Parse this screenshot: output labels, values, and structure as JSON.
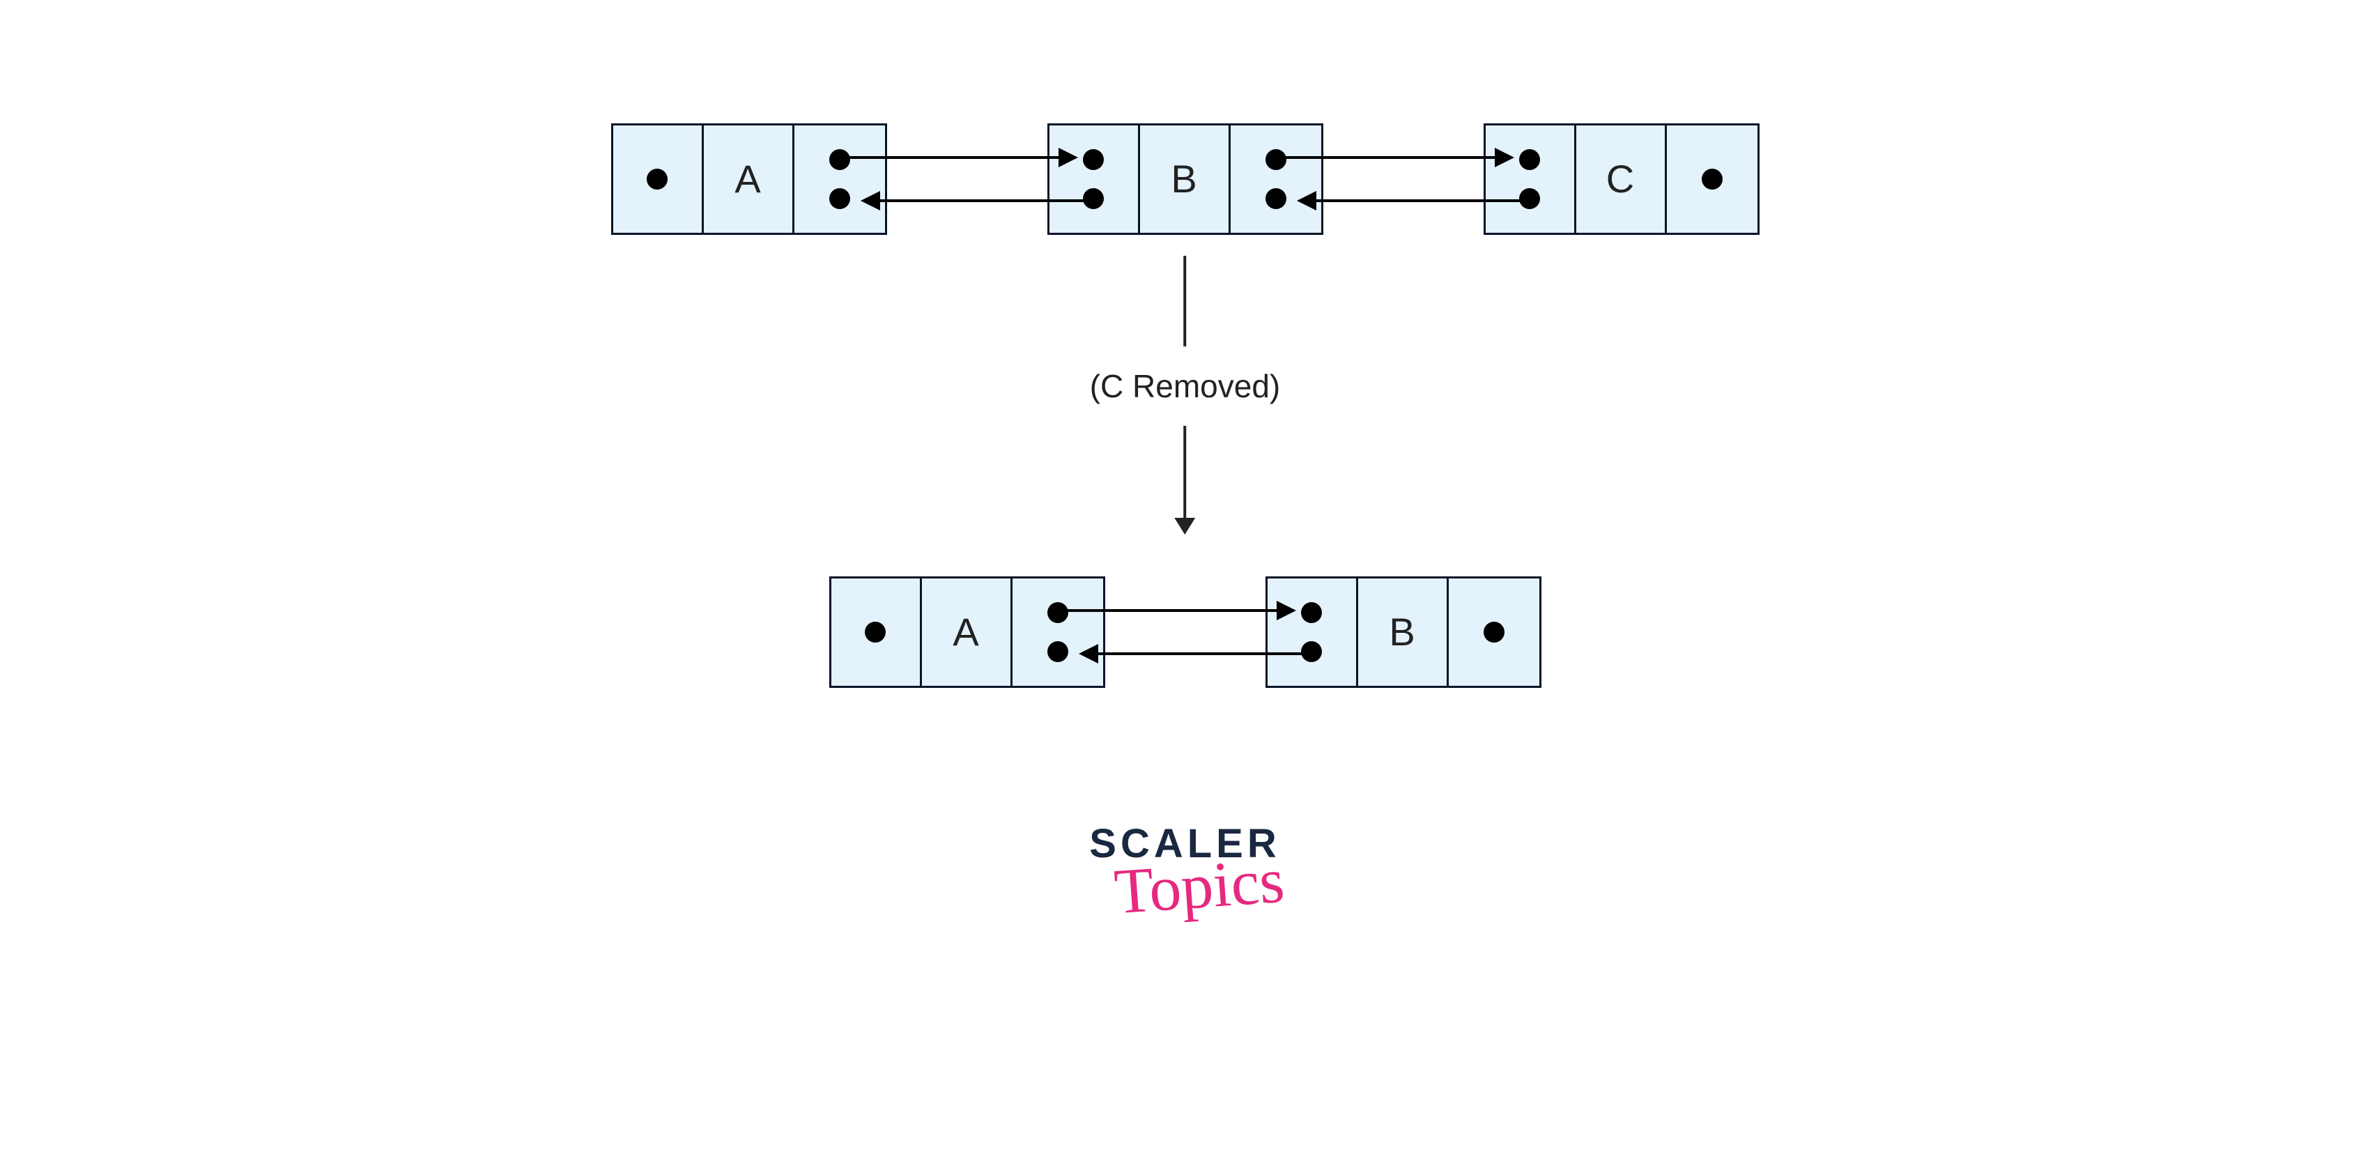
{
  "diagram": {
    "before": {
      "nodes": [
        {
          "prev": "null",
          "data": "A",
          "next": "ptr"
        },
        {
          "prev": "ptr",
          "data": "B",
          "next": "ptr"
        },
        {
          "prev": "ptr",
          "data": "C",
          "next": "null"
        }
      ]
    },
    "transition_label": "(C Removed)",
    "after": {
      "nodes": [
        {
          "prev": "null",
          "data": "A",
          "next": "ptr"
        },
        {
          "prev": "ptr",
          "data": "B",
          "next": "null"
        }
      ]
    }
  },
  "brand": {
    "line1": "SCALER",
    "line2": "Topics"
  },
  "colors": {
    "node_fill": "#e3f2fb",
    "node_border": "#0a1428",
    "text": "#222222",
    "brand_dark": "#1a2840",
    "brand_pink": "#e6297f"
  }
}
